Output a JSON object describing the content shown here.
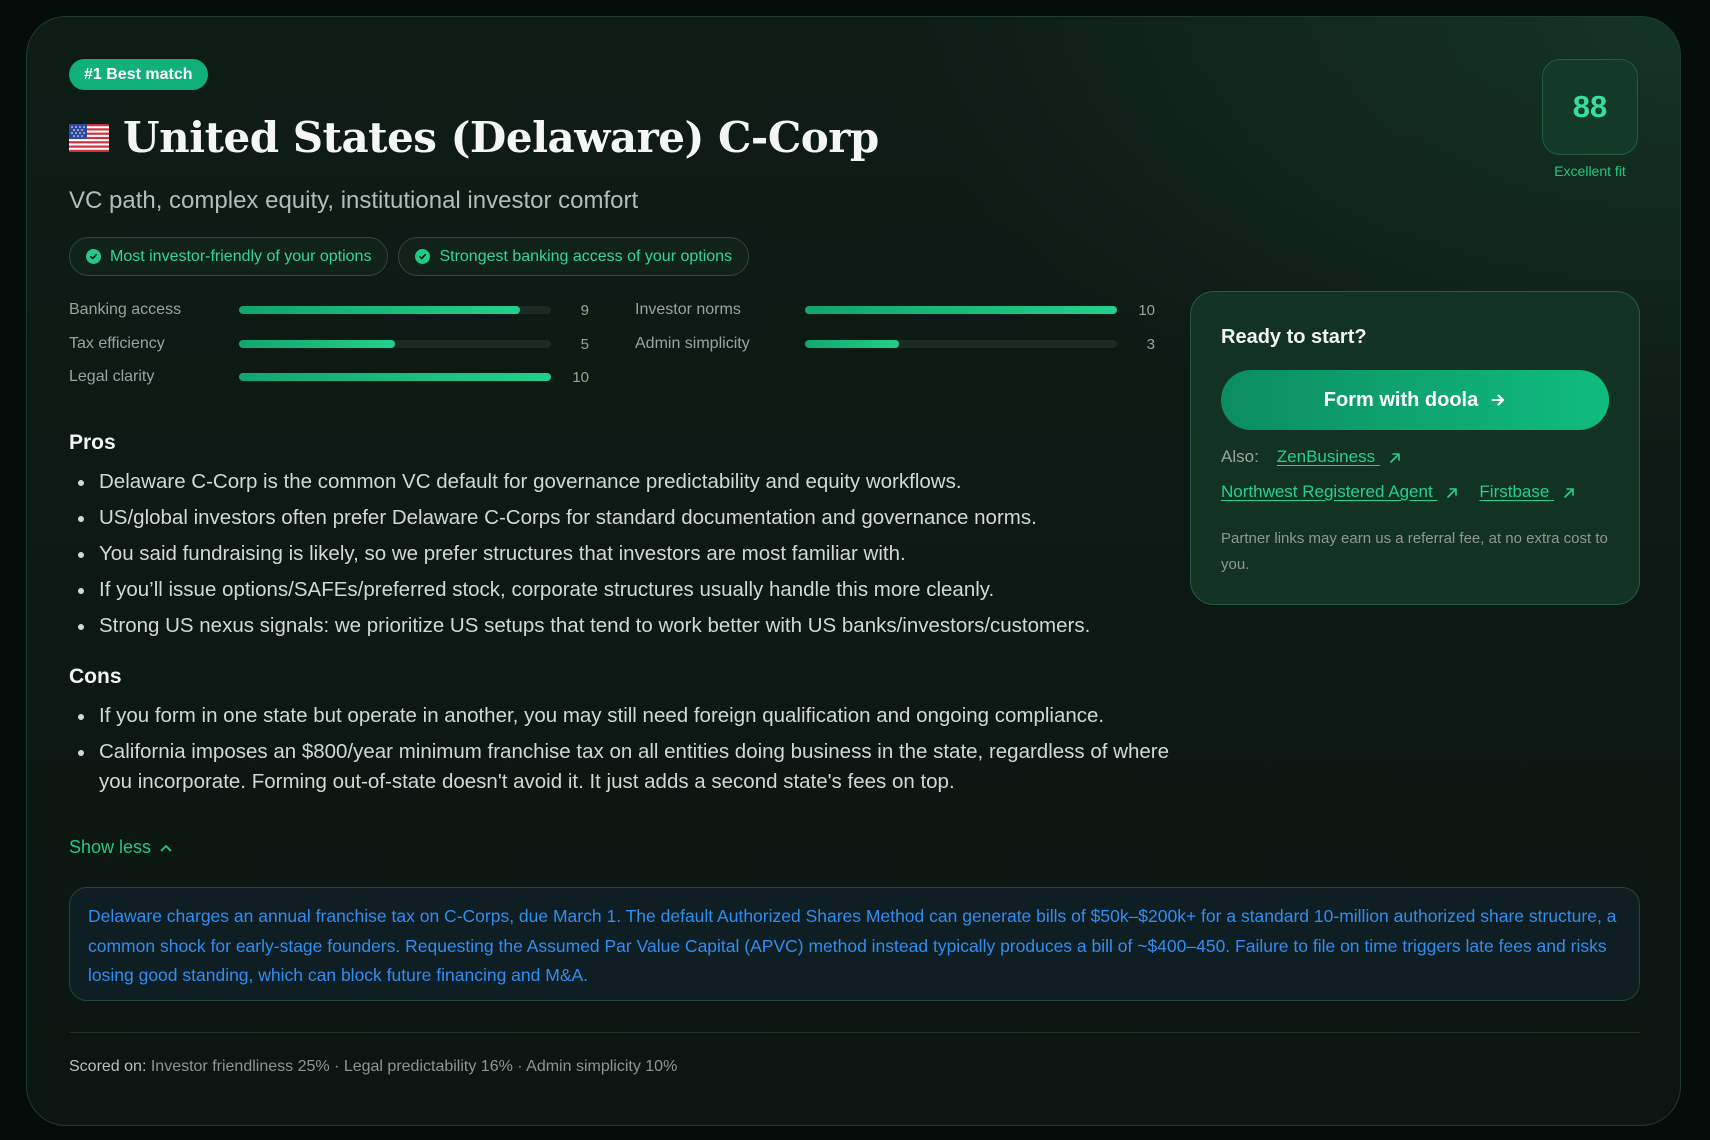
{
  "badge": "#1 Best match",
  "title": "United States (Delaware) C-Corp",
  "flag_icon": "us-flag-icon",
  "subtitle": "VC path, complex equity, institutional investor comfort",
  "highlights": [
    "Most investor-friendly of your options",
    "Strongest banking access of your options"
  ],
  "score": {
    "value": "88",
    "label": "Excellent fit"
  },
  "metrics": [
    {
      "label": "Banking access",
      "value": 9,
      "max": 10
    },
    {
      "label": "Tax efficiency",
      "value": 5,
      "max": 10
    },
    {
      "label": "Legal clarity",
      "value": 10,
      "max": 10
    },
    {
      "label": "Investor norms",
      "value": 10,
      "max": 10
    },
    {
      "label": "Admin simplicity",
      "value": 3,
      "max": 10
    }
  ],
  "pros": {
    "heading": "Pros",
    "items": [
      "Delaware C-Corp is the common VC default for governance predictability and equity workflows.",
      "US/global investors often prefer Delaware C-Corps for standard documentation and governance norms.",
      "You said fundraising is likely, so we prefer structures that investors are most familiar with.",
      "If you’ll issue options/SAFEs/preferred stock, corporate structures usually handle this more cleanly.",
      "Strong US nexus signals: we prioritize US setups that tend to work better with US banks/investors/customers."
    ]
  },
  "cons": {
    "heading": "Cons",
    "items": [
      "If you form in one state but operate in another, you may still need foreign qualification and ongoing compliance.",
      "California imposes an $800/year minimum franchise tax on all entities doing business in the state, regardless of where you incorporate. Forming out-of-state doesn't avoid it. It just adds a second state's fees on top."
    ]
  },
  "show_less": "Show less",
  "side": {
    "title": "Ready to start?",
    "cta": "Form with doola",
    "also_label": "Also:",
    "links": [
      "ZenBusiness",
      "Northwest Registered Agent",
      "Firstbase"
    ],
    "disclaimer": "Partner links may earn us a referral fee, at no extra cost to you."
  },
  "info": "Delaware charges an annual franchise tax on C-Corps, due March 1. The default Authorized Shares Method can generate bills of $50k–$200k+ for a standard 10-million authorized share structure, a common shock for early-stage founders. Requesting the Assumed Par Value Capital (APVC) method instead typically produces a bill of ~$400–450. Failure to file on time triggers late fees and risks losing good standing, which can block future financing and M&A.",
  "scored_on": {
    "label": "Scored on:",
    "text": "Investor friendliness 25% · Legal predictability 16% · Admin simplicity 10%"
  },
  "colors": {
    "accent": "#22c983",
    "info_text": "#2f8ef2",
    "background": "#050d0a"
  }
}
